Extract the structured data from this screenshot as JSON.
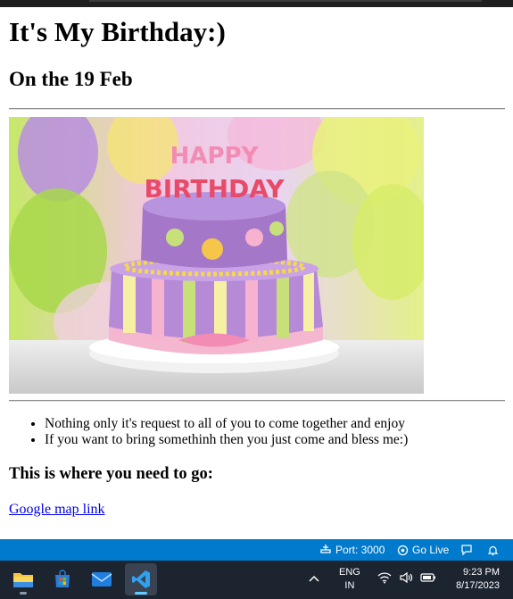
{
  "page": {
    "title": "It's My Birthday:)",
    "subtitle": "On the 19 Feb",
    "image_alt": "Happy Birthday cake",
    "cake_text": "HAPPY BIRTHDAY",
    "list_items": [
      "Nothing only it's request to all of you to come together and enjoy",
      "If you want to bring somethinh then you just come and bless me:)"
    ],
    "where_heading": "This is where you need to go:",
    "map_link": "Google map link"
  },
  "statusbar": {
    "port": "Port: 3000",
    "golive": "Go Live",
    "color": "#007acc"
  },
  "taskbar": {
    "apps": [
      "file-explorer-icon",
      "store-icon",
      "mail-icon",
      "vscode-icon"
    ],
    "lang_line1": "ENG",
    "lang_line2": "IN",
    "time": "9:23 PM",
    "date": "8/17/2023"
  }
}
